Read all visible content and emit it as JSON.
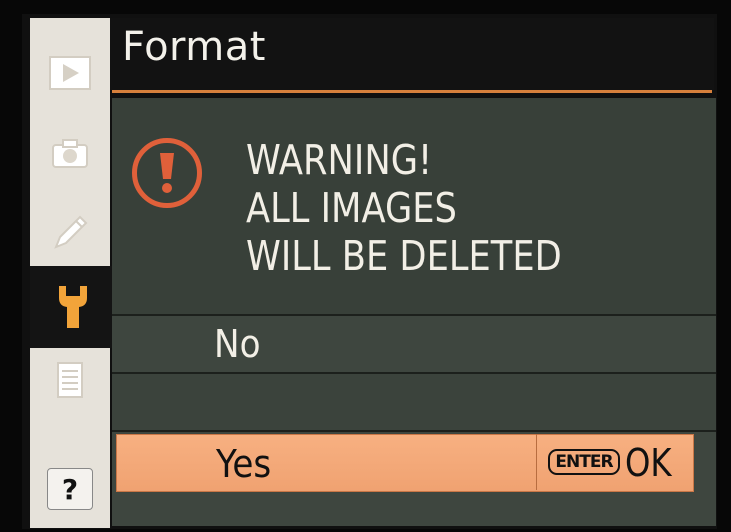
{
  "header": {
    "title": "Format"
  },
  "sidebar": {
    "tabs": [
      {
        "icon": "playback-icon"
      },
      {
        "icon": "camera-icon"
      },
      {
        "icon": "pencil-icon"
      },
      {
        "icon": "wrench-icon",
        "selected": true
      },
      {
        "icon": "retouch-icon"
      }
    ],
    "help_label": "?"
  },
  "dialog": {
    "icon": "warning-icon",
    "warning_lines": [
      "WARNING!",
      "ALL IMAGES",
      "WILL BE DELETED"
    ],
    "options": [
      {
        "label": "No"
      },
      {
        "label": "Yes",
        "selected": true
      }
    ],
    "enter_key_label": "ENTER",
    "ok_label": "OK"
  },
  "colors": {
    "accent": "#d6803c",
    "warning": "#e0603a",
    "panel": "#3e463f",
    "selection": "#f3a775"
  }
}
